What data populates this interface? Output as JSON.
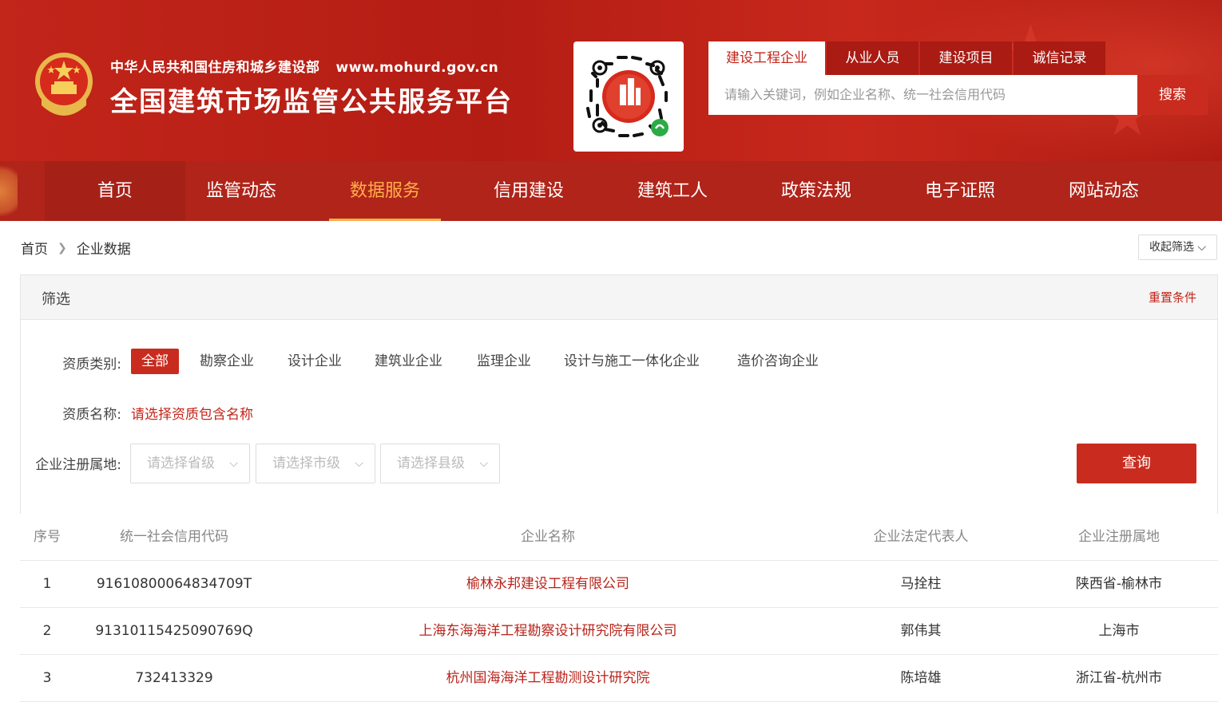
{
  "header": {
    "org_name": "中华人民共和国住房和城乡建设部",
    "org_url": "www.mohurd.gov.cn",
    "platform_title": "全国建筑市场监管公共服务平台"
  },
  "search": {
    "tabs": [
      "建设工程企业",
      "从业人员",
      "建设项目",
      "诚信记录"
    ],
    "active_tab": 0,
    "placeholder": "请输入关键词，例如企业名称、统一社会信用代码",
    "button_label": "搜索"
  },
  "nav": {
    "items": [
      "首页",
      "监管动态",
      "数据服务",
      "信用建设",
      "建筑工人",
      "政策法规",
      "电子证照",
      "网站动态"
    ],
    "active": 2
  },
  "breadcrumb": {
    "home": "首页",
    "current": "企业数据"
  },
  "collapse_label": "收起筛选",
  "filter": {
    "title": "筛选",
    "reset_label": "重置条件",
    "qual_type_label": "资质类别:",
    "qual_types": [
      "全部",
      "勘察企业",
      "设计企业",
      "建筑业企业",
      "监理企业",
      "设计与施工一体化企业",
      "造价咨询企业"
    ],
    "qual_name_label": "资质名称:",
    "qual_name_placeholder": "请选择资质包含名称",
    "region_label": "企业注册属地:",
    "province_placeholder": "请选择省级",
    "city_placeholder": "请选择市级",
    "county_placeholder": "请选择县级",
    "query_label": "查询"
  },
  "table": {
    "headers": [
      "序号",
      "统一社会信用代码",
      "企业名称",
      "企业法定代表人",
      "企业注册属地"
    ],
    "rows": [
      {
        "no": "1",
        "code": "91610800064834709T",
        "name": "榆林永邦建设工程有限公司",
        "rep": "马拴柱",
        "region": "陕西省-榆林市"
      },
      {
        "no": "2",
        "code": "91310115425090769Q",
        "name": "上海东海海洋工程勘察设计研究院有限公司",
        "rep": "郭伟其",
        "region": "上海市"
      },
      {
        "no": "3",
        "code": "732413329",
        "name": "杭州国海海洋工程勘测设计研究院",
        "rep": "陈培雄",
        "region": "浙江省-杭州市"
      }
    ]
  },
  "colors": {
    "brand_red": "#c2251a",
    "nav_bg": "#b0241a",
    "nav_active": "#ffb04a"
  }
}
